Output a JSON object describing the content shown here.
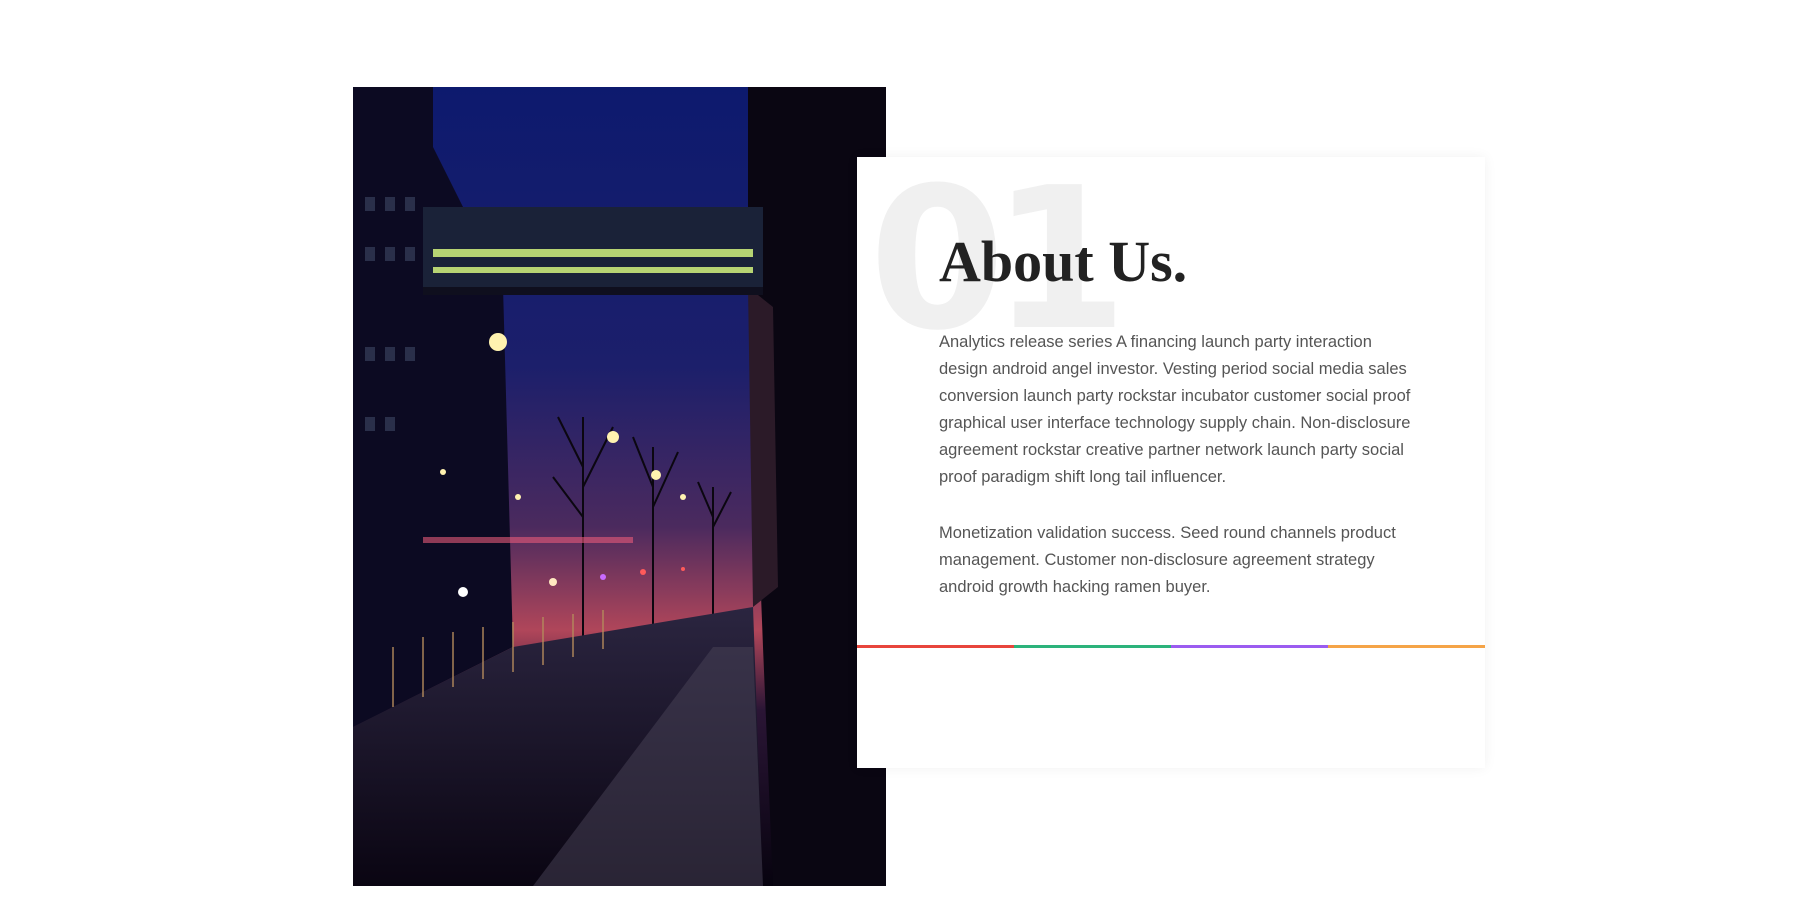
{
  "about": {
    "number": "01",
    "title": "About Us.",
    "paragraphs": [
      "Analytics release series A financing launch party interaction design android angel investor. Vesting period social media sales conversion launch party rockstar incubator customer social proof graphical user interface technology supply chain. Non-disclosure agreement rockstar creative partner network launch party social proof paradigm shift long tail influencer.",
      "Monetization validation success. Seed round channels product management. Customer non-disclosure agreement strategy android growth hacking ramen buyer."
    ],
    "accent_colors": [
      "#e8453c",
      "#2cb37b",
      "#9b5cf0",
      "#f5a447"
    ]
  },
  "photo": {
    "subject": "city-street-at-night-image"
  }
}
